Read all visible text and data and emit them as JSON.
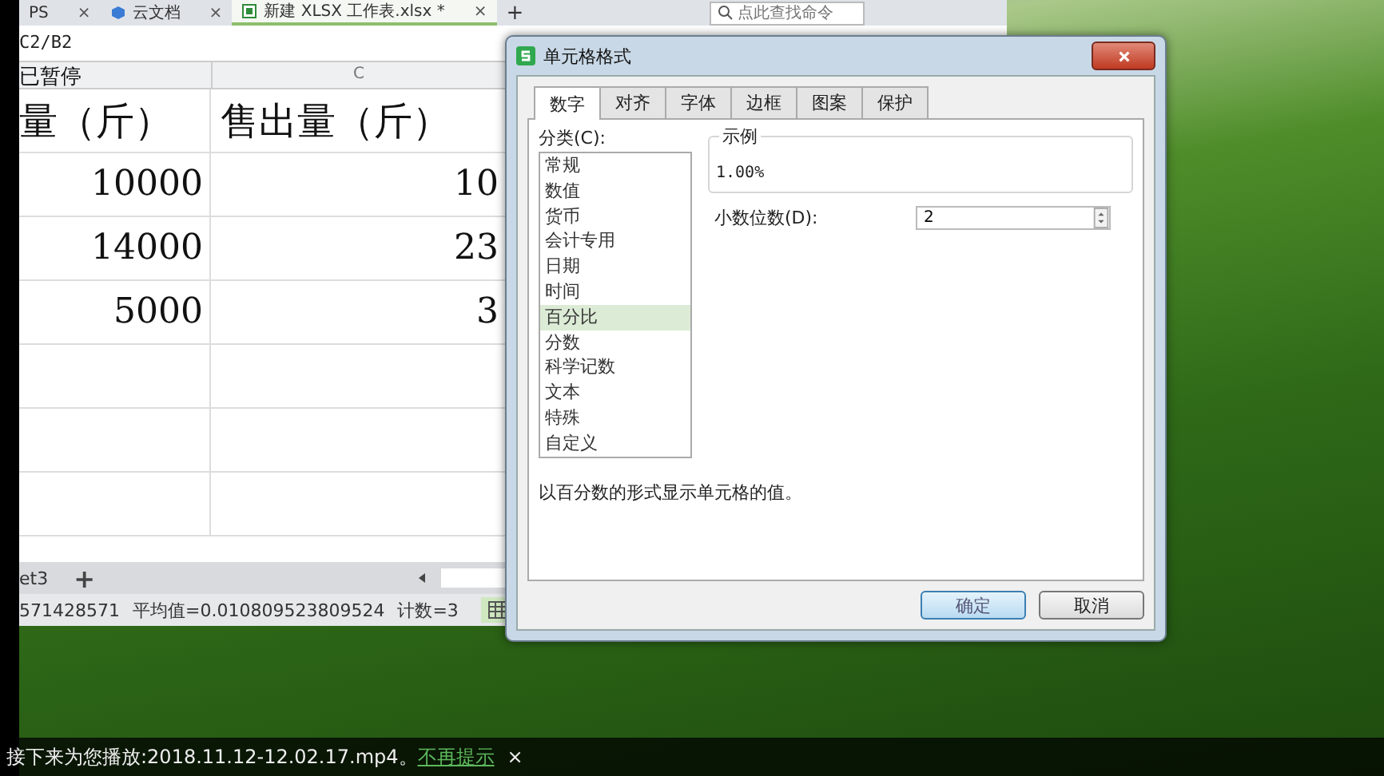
{
  "spreadsheet": {
    "tabs": [
      {
        "label": "PS",
        "kind": "plain",
        "selected": false,
        "close": "×"
      },
      {
        "label": "云文档",
        "kind": "cloud",
        "selected": false,
        "close": "×"
      },
      {
        "label": "新建 XLSX 工作表.xlsx *",
        "kind": "file",
        "selected": true,
        "close": "×"
      }
    ],
    "new_tab": "+",
    "search_placeholder": "点此查找命令",
    "formula": "C2/B2",
    "paused_notice": "已暂停",
    "column_headers": [
      "C"
    ],
    "rows": [
      [
        "量（斤）",
        "售出量（斤）"
      ],
      [
        "10000",
        "10"
      ],
      [
        "14000",
        "23"
      ],
      [
        "5000",
        "3"
      ]
    ],
    "sheet_tab": "et3",
    "add_sheet": "+",
    "status": [
      "571428571",
      "平均值=0.010809523809524",
      "计数=3"
    ]
  },
  "dialog": {
    "title": "单元格格式",
    "tabs": [
      {
        "label": "数字",
        "selected": true
      },
      {
        "label": "对齐",
        "selected": false
      },
      {
        "label": "字体",
        "selected": false
      },
      {
        "label": "边框",
        "selected": false
      },
      {
        "label": "图案",
        "selected": false
      },
      {
        "label": "保护",
        "selected": false
      }
    ],
    "category_label": "分类(C):",
    "categories": [
      {
        "label": "常规",
        "selected": false
      },
      {
        "label": "数值",
        "selected": false
      },
      {
        "label": "货币",
        "selected": false
      },
      {
        "label": "会计专用",
        "selected": false
      },
      {
        "label": "日期",
        "selected": false
      },
      {
        "label": "时间",
        "selected": false
      },
      {
        "label": "百分比",
        "selected": true
      },
      {
        "label": "分数",
        "selected": false
      },
      {
        "label": "科学记数",
        "selected": false
      },
      {
        "label": "文本",
        "selected": false
      },
      {
        "label": "特殊",
        "selected": false
      },
      {
        "label": "自定义",
        "selected": false
      }
    ],
    "sample_label": "示例",
    "sample_value": "1.00%",
    "decimals_label": "小数位数(D):",
    "decimals_value": "2",
    "description": "以百分数的形式显示单元格的值。",
    "buttons": [
      {
        "label": "确定",
        "default": true
      },
      {
        "label": "取消",
        "default": false
      }
    ]
  },
  "player": {
    "notice": "接下来为您播放:2018.11.12-12.02.17.mp4。",
    "link": "不再提示",
    "close": "×"
  }
}
